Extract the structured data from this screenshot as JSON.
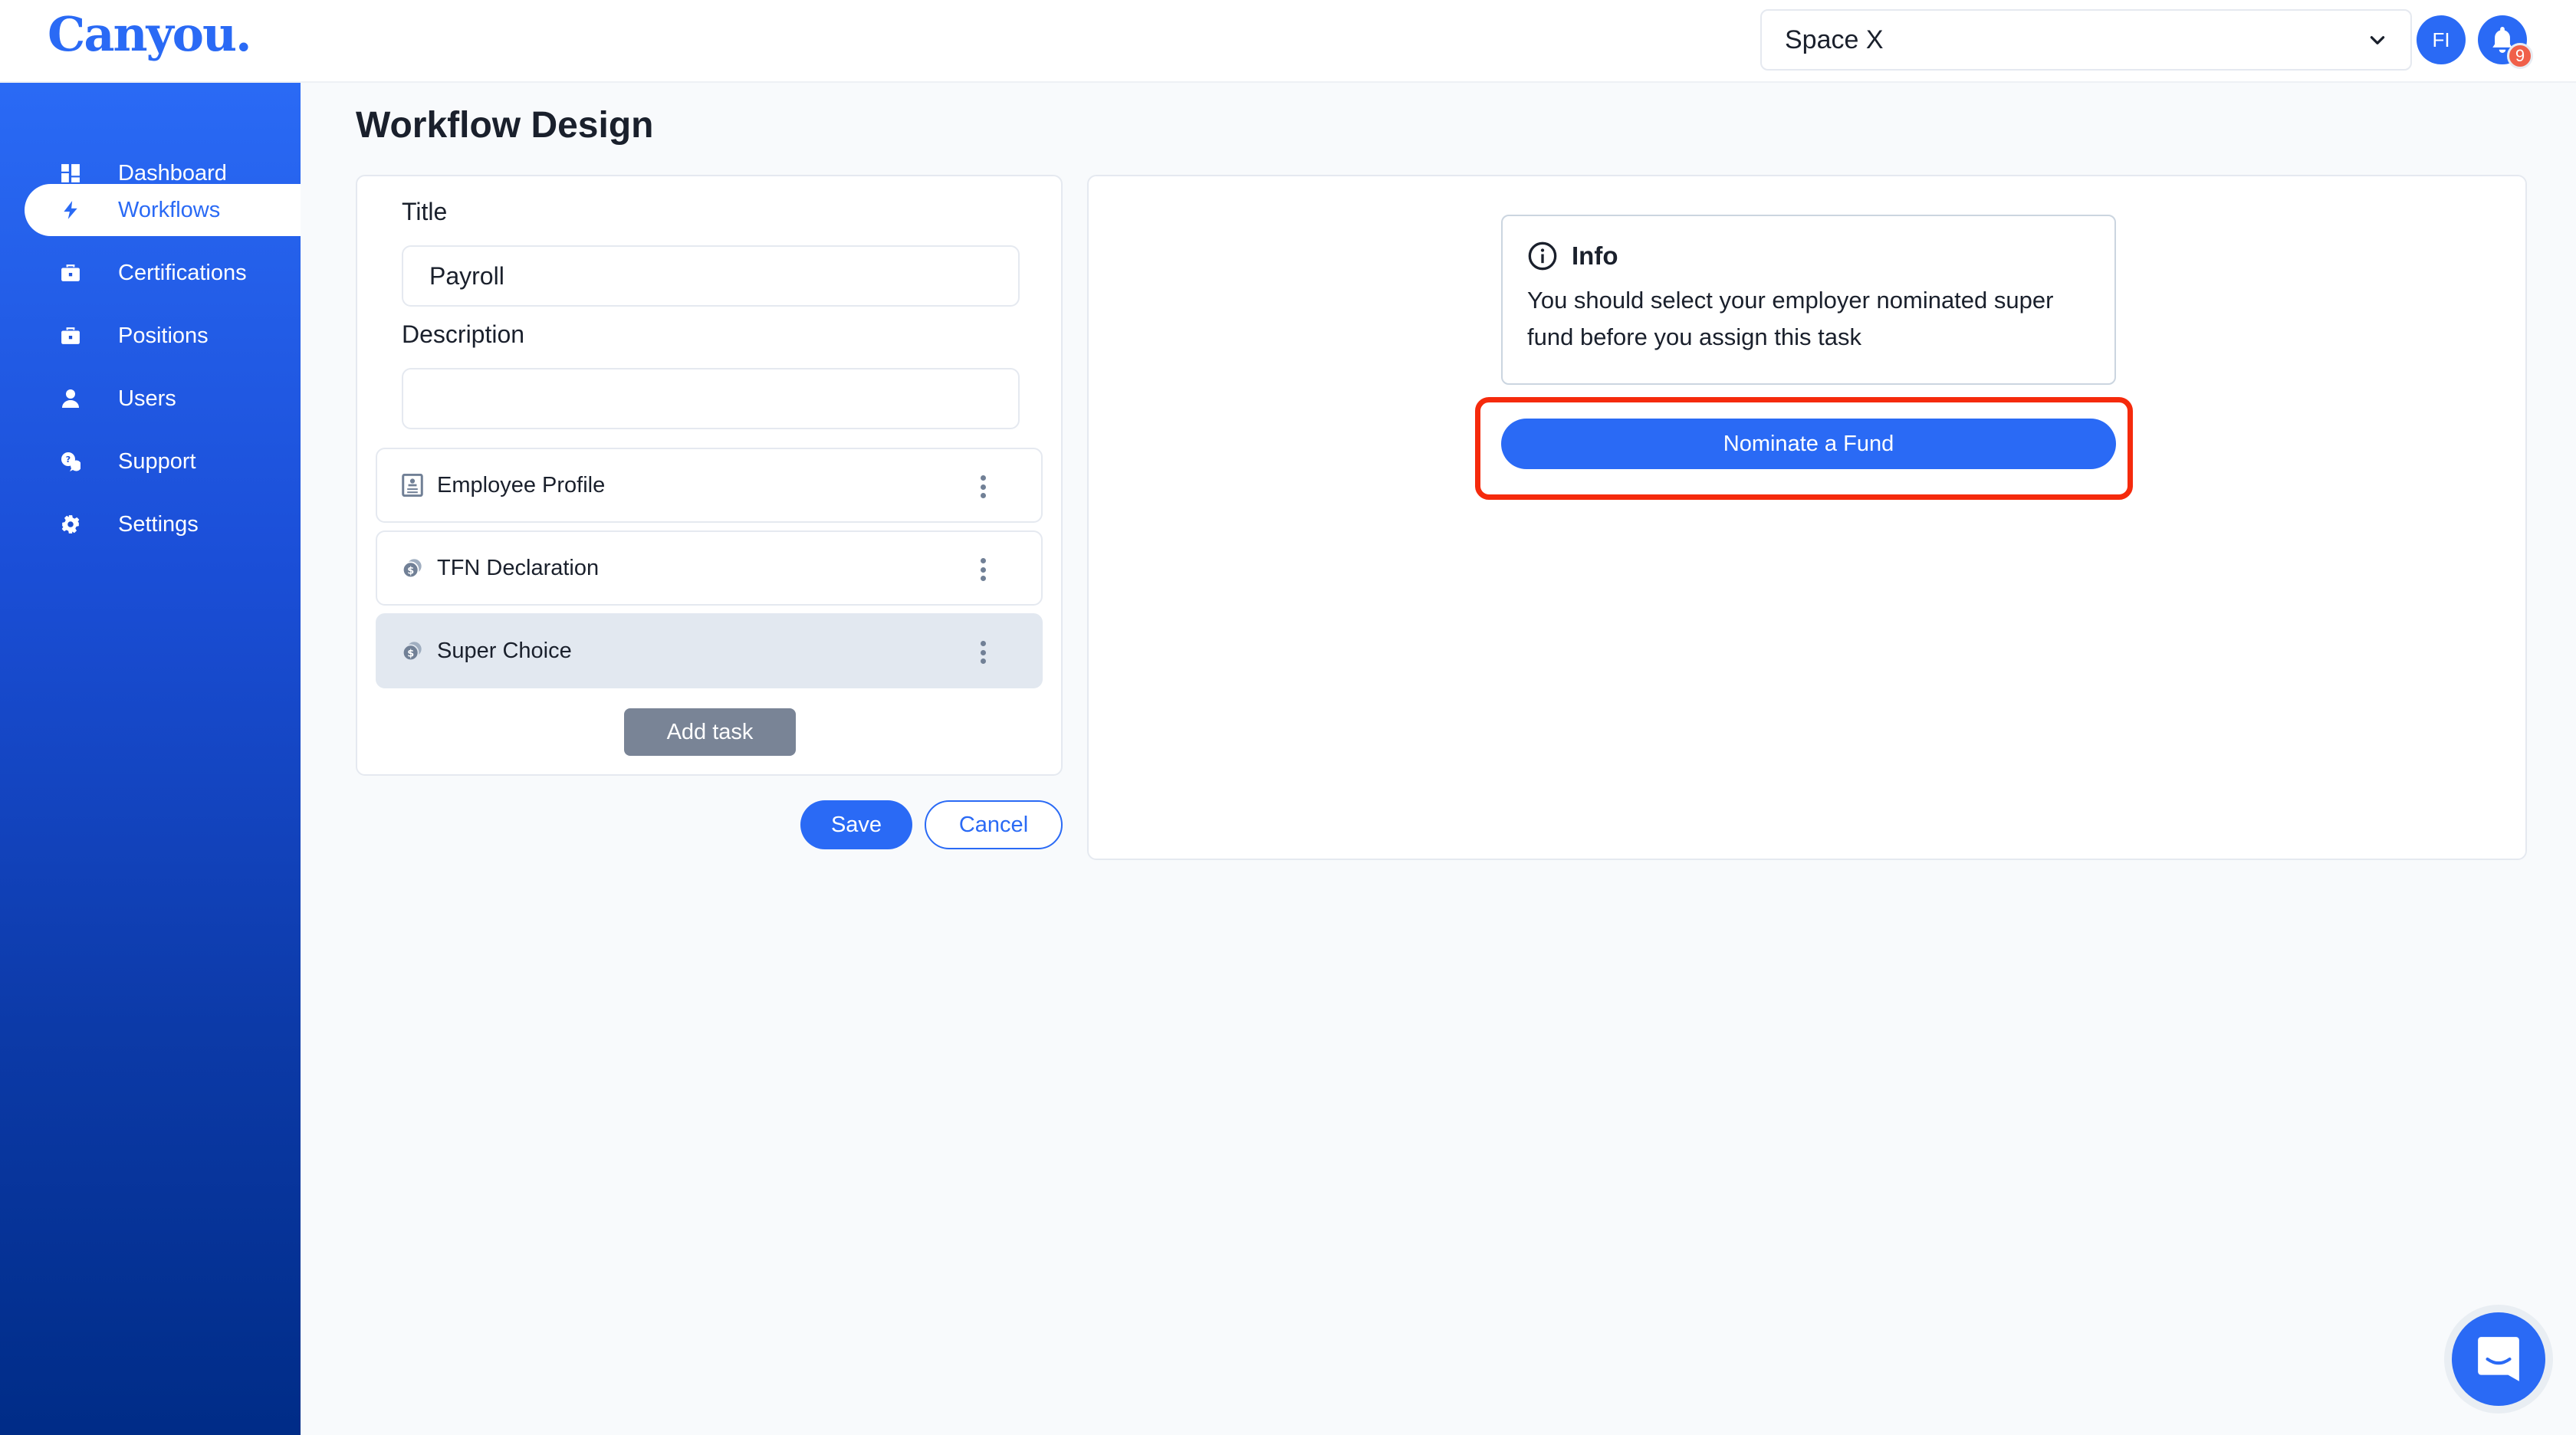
{
  "header": {
    "logo": "Canyou.",
    "space_select": {
      "value": "Space X"
    },
    "avatar_initials": "FI",
    "notifications_count": "9"
  },
  "sidebar": {
    "items": [
      {
        "label": "Dashboard",
        "icon": "dashboard-icon",
        "active": false
      },
      {
        "label": "Workflows",
        "icon": "lightning-icon",
        "active": true
      },
      {
        "label": "Certifications",
        "icon": "briefcase-icon",
        "active": false
      },
      {
        "label": "Positions",
        "icon": "briefcase-icon",
        "active": false
      },
      {
        "label": "Users",
        "icon": "user-icon",
        "active": false
      },
      {
        "label": "Support",
        "icon": "support-chat-icon",
        "active": false
      },
      {
        "label": "Settings",
        "icon": "gear-icon",
        "active": false
      }
    ]
  },
  "page": {
    "title": "Workflow Design"
  },
  "form": {
    "title_label": "Title",
    "title_value": "Payroll",
    "description_label": "Description",
    "description_value": "",
    "tasks": [
      {
        "label": "Employee Profile",
        "icon": "profile-card-icon",
        "selected": false
      },
      {
        "label": "TFN Declaration",
        "icon": "coins-icon",
        "selected": false
      },
      {
        "label": "Super Choice",
        "icon": "coins-icon",
        "selected": true
      }
    ],
    "add_task_label": "Add task",
    "save_label": "Save",
    "cancel_label": "Cancel"
  },
  "detail": {
    "info_title": "Info",
    "info_text": "You should select your employer nominated super fund before you assign this task",
    "nominate_label": "Nominate a Fund"
  },
  "colors": {
    "brand": "#2a6af5",
    "highlight": "#f52a0c",
    "badge": "#f0604a"
  }
}
